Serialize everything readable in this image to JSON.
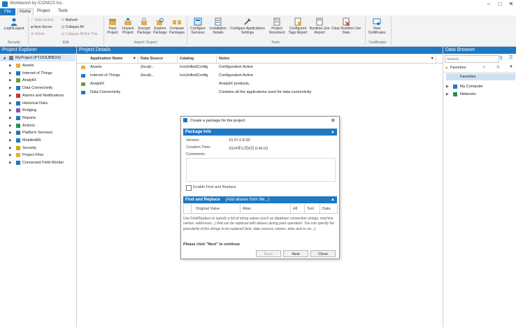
{
  "window": {
    "title": "Workbench by ICONICS Inc."
  },
  "menu": {
    "tabs": [
      "File",
      "Home",
      "Project",
      "Tools"
    ]
  },
  "ribbon": {
    "security": {
      "button": "Login/Logout",
      "group": "Security"
    },
    "edit": {
      "make_active": "Make Active",
      "new_server": "New Server",
      "delete": "Delete",
      "refresh": "Refresh",
      "collapse_all": "Collapse All",
      "collapse_all_but": "Collapse All But This",
      "group": "Edit"
    },
    "import_export": {
      "buttons": [
        "Pack Project",
        "Unpack Project",
        "Encrypt Package",
        "Explore Package",
        "Compare Packages"
      ],
      "group": "Import / Export"
    },
    "tools": {
      "buttons": [
        "Configure Services",
        "Installation Details",
        "Configure Applications Settings",
        "Project Document",
        "Configured Tags Report",
        "Runtime Use Report",
        "Clear Runtime Use Data"
      ],
      "group": "Tools"
    },
    "certificates": {
      "button": "View Certificates",
      "group": "Certificates"
    }
  },
  "project_explorer": {
    "title": "Project Explorer",
    "root": "MyProject (PT.DOUBBOX)",
    "items": [
      "Assets",
      "Internet of Things",
      "AnalytiX",
      "Data Connectivity",
      "Alarms and Notifications",
      "Historical Data",
      "Bridging",
      "Reports",
      "Actions",
      "Platform Services",
      "MobileHMI",
      "Security",
      "Project Files",
      "Connected Field Worker"
    ]
  },
  "project_details": {
    "title": "Project Details",
    "columns": [
      "Application Name",
      "Data Source",
      "Catalog",
      "Notes"
    ],
    "rows": [
      {
        "name": "Assets",
        "source": "(local)...",
        "catalog": "IcoUnifiedConfig",
        "notes": "Configuration Active"
      },
      {
        "name": "Internet of Things",
        "source": "(local)...",
        "catalog": "IcoUnifiedConfig",
        "notes": "Configuration Active"
      },
      {
        "name": "AnalytiX",
        "source": "",
        "catalog": "",
        "notes": "AnalytiX products."
      },
      {
        "name": "Data Connectivity",
        "source": "",
        "catalog": "",
        "notes": "Contains all the applications used for data connectivity"
      }
    ]
  },
  "data_browser": {
    "title": "Data Browser",
    "search_placeholder": "Search",
    "favorites_label": "Favorites",
    "favorites_item": "Favorites",
    "items": [
      "My Computer",
      "Networks"
    ]
  },
  "dialog": {
    "title": "Create a package for the project",
    "package_info": {
      "header": "Package Info",
      "version_label": "Version:",
      "version_value": "10.97.0.8.00",
      "creation_label": "Creation Time:",
      "creation_value": "2024年/1月8日 8:46:03",
      "comments_label": "Comments:",
      "enable_label": "Enable Find and Replace"
    },
    "find_replace": {
      "header": "Find and Replace",
      "header_hint": "(Add aliases from file...)",
      "columns": [
        "Original Value",
        "Alias",
        "All",
        "Text",
        "Data"
      ]
    },
    "help_text": "Use Find/Replace to specify a list of string values (such as database connection strings, machine names, addresses...) that can be replaced with aliases during pack operation. You can specify the granularity of the strings to be replaced (text, data sources, names, alias and so on...).",
    "prompt": "Please click \"Next\" to continue",
    "buttons": {
      "back": "Back",
      "next": "Next",
      "close": "Close"
    }
  },
  "colors": {
    "accent": "#1e78c2",
    "ribbon_bg": "#f3f3f3",
    "header_fg": "#ffffff"
  }
}
